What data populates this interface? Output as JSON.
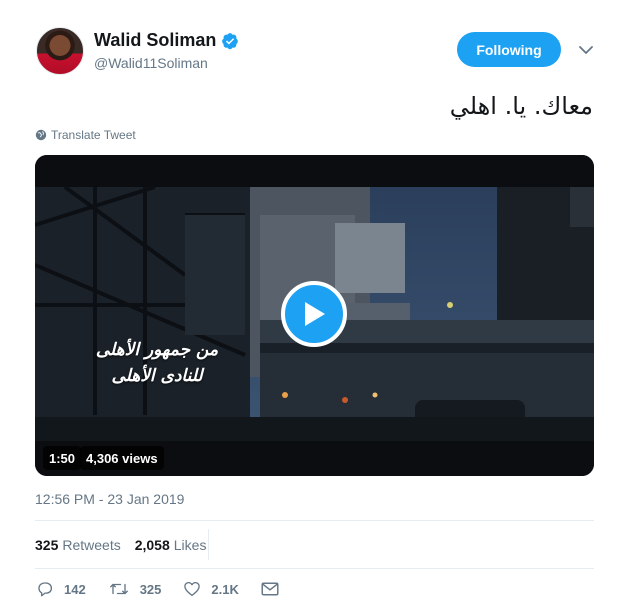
{
  "author": {
    "display_name": "Walid Soliman",
    "handle": "@Walid11Soliman",
    "verified": true,
    "avatar_icon": "profile-photo"
  },
  "follow_button": {
    "label": "Following",
    "color": "#1da1f2"
  },
  "tweet": {
    "text": "معاك. يا. اهلي",
    "translate_label": "Translate Tweet"
  },
  "video": {
    "overlay_line1": "من جمهور الأهلى",
    "overlay_line2": "للنادى الأهلى",
    "duration": "1:50",
    "views": "4,306 views",
    "play_icon": "play-icon"
  },
  "timestamp": "12:56 PM - 23 Jan 2019",
  "stats": {
    "retweets_count": "325",
    "retweets_label": "Retweets",
    "likes_count": "2,058",
    "likes_label": "Likes"
  },
  "actions": {
    "reply_count": "142",
    "retweet_count": "325",
    "like_count": "2.1K",
    "dm_icon": "envelope-icon"
  },
  "colors": {
    "accent": "#1da1f2",
    "text_primary": "#14171a",
    "text_secondary": "#657786",
    "divider": "#e6ecf0"
  }
}
